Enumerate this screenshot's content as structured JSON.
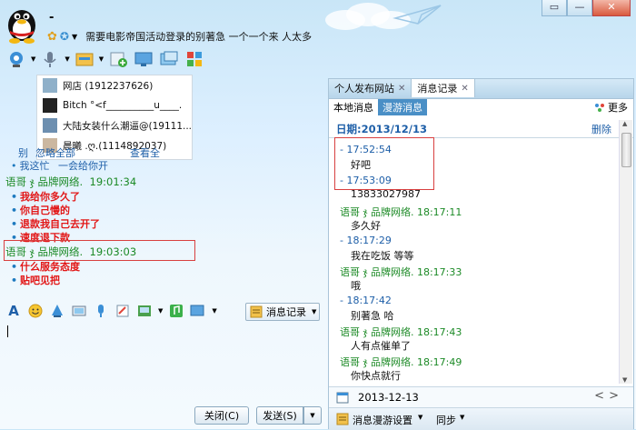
{
  "window": {
    "title_name": "-",
    "signature": "需要电影帝国活动登录的别著急 一个一个来 人太多",
    "controls": [
      "▭",
      "—",
      "✕"
    ]
  },
  "members": {
    "items": [
      {
        "name": "网店 (1912237626)",
        "color": "#333"
      },
      {
        "name": "Bitch °<f__________u____.",
        "color": "#777"
      },
      {
        "name": "大陆女装什么潮逼@(19111...",
        "color": "#c4477a"
      },
      {
        "name": "晨曦          .ღ.(1114892037)",
        "color": "#8a8a8a"
      }
    ],
    "links": [
      "别",
      "忽略全部",
      "查看全"
    ]
  },
  "chat": {
    "pre_lines": [
      "我这忙",
      "一会给你开"
    ],
    "messages": [
      {
        "sender": "语哥 ჯ 品牌网络.",
        "time": "19:01:34",
        "lines": [
          "我给你多久了",
          "你自己慢的",
          "退款我自己去开了",
          "速度退下款"
        ]
      },
      {
        "sender": "语哥 ჯ 品牌网络.",
        "time": "19:03:03",
        "lines": [
          "什么服务态度",
          "贴吧见把"
        ]
      }
    ]
  },
  "input_toolbar": {
    "history_label": "消息记录"
  },
  "actions": {
    "close_label": "关闭(C)",
    "send_label": "发送(S)"
  },
  "history_panel": {
    "tabs": [
      {
        "label": "个人发布网站",
        "active": false
      },
      {
        "label": "消息记录",
        "active": true
      }
    ],
    "subtabs": [
      {
        "label": "本地消息",
        "active": false
      },
      {
        "label": "漫游消息",
        "active": true
      }
    ],
    "more_label": "更多",
    "date_header": "日期:2013/12/13",
    "delete_label": "删除",
    "records": [
      {
        "kind": "time",
        "text": "- 17:52:54"
      },
      {
        "kind": "body",
        "text": "好吧"
      },
      {
        "kind": "time",
        "text": "- 17:53:09"
      },
      {
        "kind": "body",
        "text": "13833027987"
      },
      {
        "kind": "sender",
        "text": "语哥 ჯ 品牌网络. 18:17:11"
      },
      {
        "kind": "body",
        "text": "多久好"
      },
      {
        "kind": "time",
        "text": "- 18:17:29"
      },
      {
        "kind": "body",
        "text": "我在吃饭 等等"
      },
      {
        "kind": "sender",
        "text": "语哥 ჯ 品牌网络. 18:17:33"
      },
      {
        "kind": "body",
        "text": "哦"
      },
      {
        "kind": "time",
        "text": "- 18:17:42"
      },
      {
        "kind": "body",
        "text": "别著急 哈"
      },
      {
        "kind": "sender",
        "text": "语哥 ჯ 品牌网络. 18:17:43"
      },
      {
        "kind": "body",
        "text": "人有点催单了"
      },
      {
        "kind": "sender",
        "text": "语哥 ჯ 品牌网络. 18:17:49"
      },
      {
        "kind": "body",
        "text": "你快点就行"
      }
    ],
    "date_value": "2013-12-13",
    "nav_prev": "<",
    "nav_next": ">",
    "roam_settings_label": "消息漫游设置",
    "sync_label": "同步"
  },
  "colors": {
    "sender_green": "#1c8a26",
    "message_red": "#e21616",
    "time_blue": "#1e5fa8",
    "highlight_box": "#d84040"
  }
}
